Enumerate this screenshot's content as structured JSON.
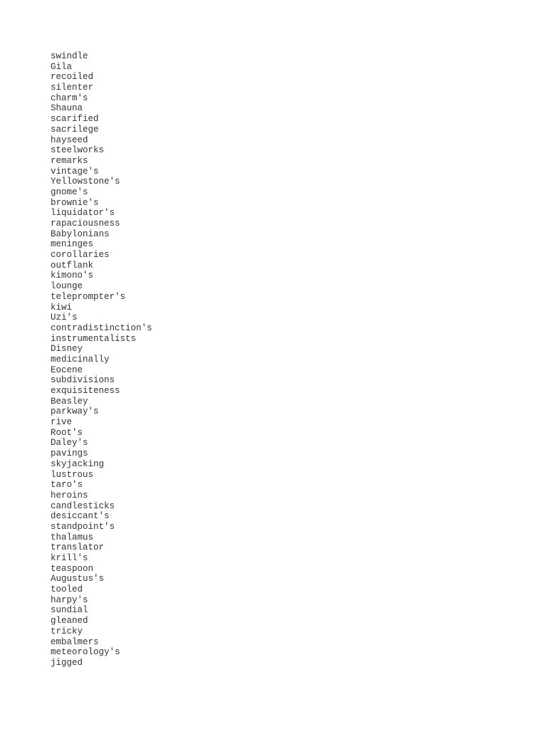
{
  "document": {
    "words": [
      "swindle",
      "Gila",
      "recoiled",
      "silenter",
      "charm's",
      "Shauna",
      "scarified",
      "sacrilege",
      "hayseed",
      "steelworks",
      "remarks",
      "vintage's",
      "Yellowstone's",
      "gnome's",
      "brownie's",
      "liquidator's",
      "rapaciousness",
      "Babylonians",
      "meninges",
      "corollaries",
      "outflank",
      "kimono's",
      "lounge",
      "teleprompter's",
      "kiwi",
      "Uzi's",
      "contradistinction's",
      "instrumentalists",
      "Disney",
      "medicinally",
      "Eocene",
      "subdivisions",
      "exquisiteness",
      "Beasley",
      "parkway's",
      "rive",
      "Root's",
      "Daley's",
      "pavings",
      "skyjacking",
      "lustrous",
      "taro's",
      "heroins",
      "candlesticks",
      "desiccant's",
      "standpoint's",
      "thalamus",
      "translator",
      "krill's",
      "teaspoon",
      "Augustus's",
      "tooled",
      "harpy's",
      "sundial",
      "gleaned",
      "tricky",
      "embalmers",
      "meteorology's",
      "jigged"
    ]
  }
}
